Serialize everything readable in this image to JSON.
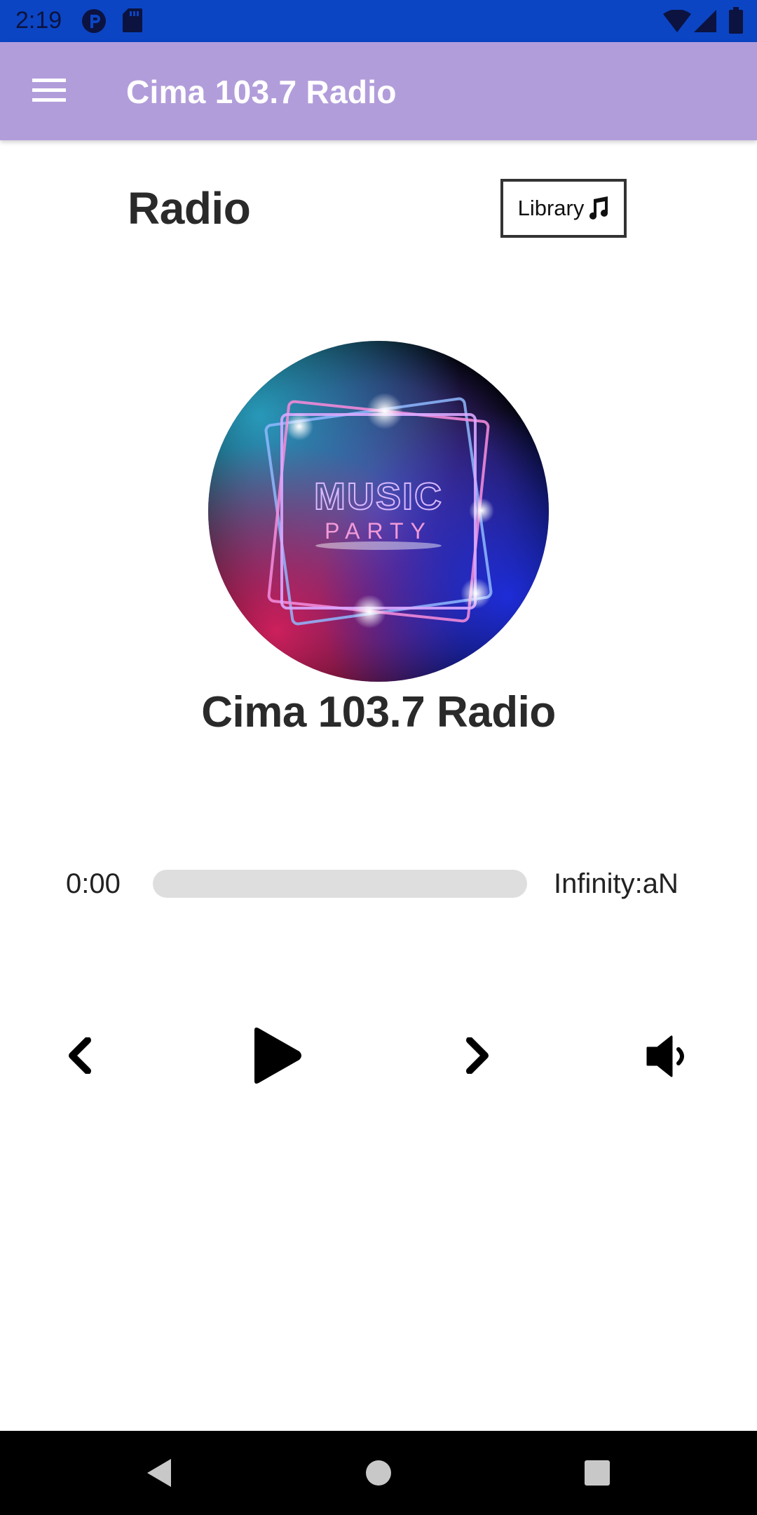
{
  "status_bar": {
    "time": "2:19",
    "background_color": "#0b45c4",
    "icons": [
      "notification-p-icon",
      "sd-card-icon",
      "wifi-icon",
      "signal-icon",
      "battery-icon"
    ]
  },
  "app_bar": {
    "title": "Cima 103.7 Radio",
    "background_color": "#b29ddb",
    "menu_icon": "hamburger-menu-icon"
  },
  "header": {
    "title": "Radio",
    "library_button_label": "Library",
    "library_icon": "music-note-icon"
  },
  "player": {
    "artwork_text_line1": "MUSIC",
    "artwork_text_line2": "PARTY",
    "station_name": "Cima 103.7 Radio",
    "time_current": "0:00",
    "time_total": "Infinity:aN",
    "progress": 0
  },
  "controls": {
    "prev_icon": "chevron-left-icon",
    "play_icon": "play-icon",
    "next_icon": "chevron-right-icon",
    "volume_icon": "volume-icon"
  },
  "nav_bar": {
    "icons": [
      "back-icon",
      "home-icon",
      "recents-icon"
    ]
  }
}
